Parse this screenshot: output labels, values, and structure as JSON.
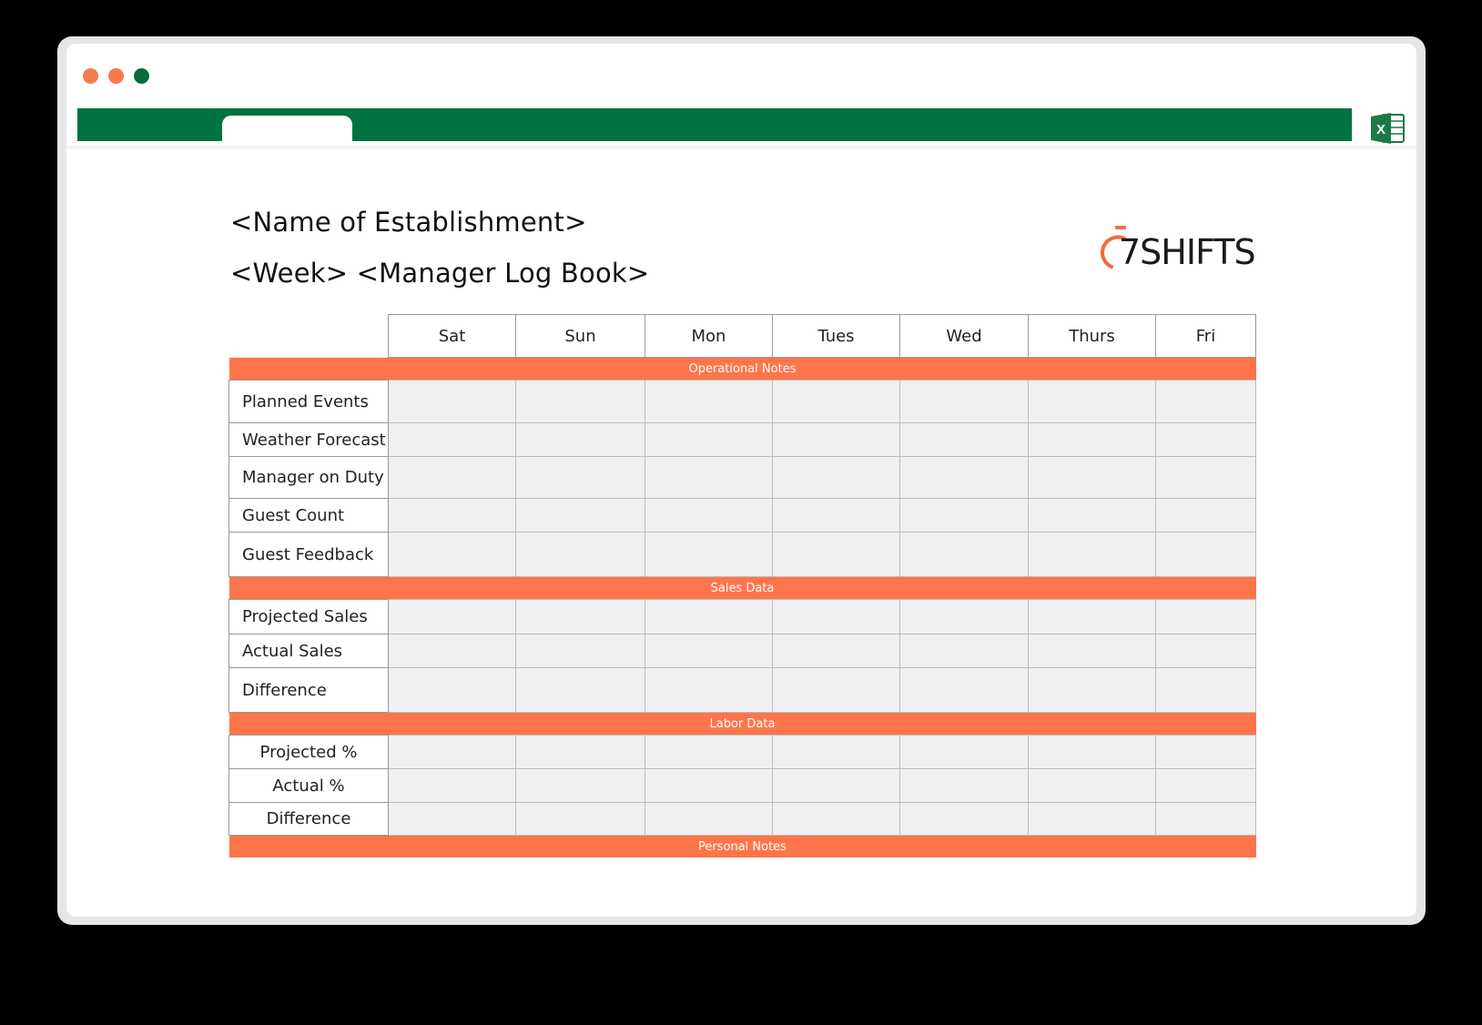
{
  "window": {
    "controls": [
      "close",
      "minimize",
      "maximize"
    ],
    "control_colors": [
      "#f47a4e",
      "#f47a4e",
      "#0a6b3a"
    ]
  },
  "ribbon": {
    "color": "#017342",
    "app_icon": "excel-icon",
    "app_icon_letter": "X"
  },
  "sheet": {
    "title": "<Name of Establishment>",
    "subtitle": "<Week> <Manager Log Book>"
  },
  "logo": {
    "text": "7SHIFTS",
    "accent": "#f26b3a"
  },
  "table": {
    "days": [
      "Sat",
      "Sun",
      "Mon",
      "Tues",
      "Wed",
      "Thurs",
      "Fri"
    ],
    "sections": [
      {
        "title": "Operational Notes",
        "rows": [
          "Planned Events",
          "Weather Forecast",
          "Manager on Duty",
          "Guest Count",
          "Guest Feedback"
        ]
      },
      {
        "title": "Sales Data",
        "rows": [
          "Projected Sales",
          "Actual Sales",
          "Difference"
        ]
      },
      {
        "title": "Labor Data",
        "rows": [
          "Projected %",
          "Actual %",
          "Difference"
        ]
      },
      {
        "title": "Personal Notes",
        "rows": []
      }
    ],
    "section_color": "#ff754b"
  }
}
